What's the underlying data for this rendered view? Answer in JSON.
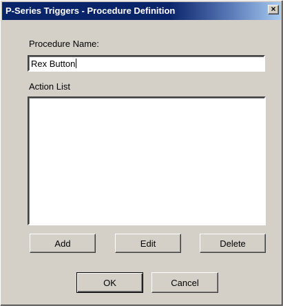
{
  "window": {
    "title": "P-Series Triggers - Procedure Definition",
    "close_label": "×"
  },
  "form": {
    "procedure_name_label": "Procedure Name:",
    "procedure_name_value": "Rex Button",
    "action_list_label": "Action List",
    "action_list_items": []
  },
  "buttons": {
    "add": "Add",
    "edit": "Edit",
    "delete": "Delete",
    "ok": "OK",
    "cancel": "Cancel"
  },
  "colors": {
    "dialog_bg": "#d4d0c8",
    "titlebar_start": "#0a246a",
    "titlebar_end": "#a6caf0"
  }
}
